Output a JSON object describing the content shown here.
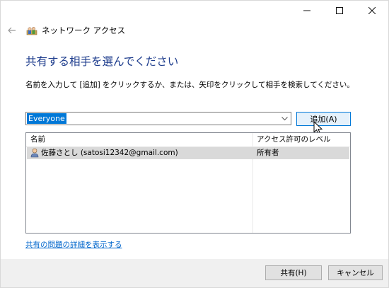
{
  "window": {
    "title": "ネットワーク アクセス",
    "controls": {
      "minimize_icon": "minimize-icon",
      "maximize_icon": "maximize-icon",
      "close_icon": "close-icon"
    }
  },
  "header": {
    "back_icon": "back-arrow-icon",
    "app_icon": "network-users-icon"
  },
  "heading": "共有する相手を選んでください",
  "instruction": "名前を入力して [追加] をクリックするか、または、矢印をクリックして相手を検索してください。",
  "combo": {
    "value": "Everyone"
  },
  "add_button": "追加(A)",
  "list": {
    "columns": [
      "名前",
      "アクセス許可のレベル"
    ],
    "rows": [
      {
        "name": "佐藤さとし (satosi12342@gmail.com)",
        "permission": "所有者",
        "selected": true
      }
    ]
  },
  "link": "共有の問題の詳細を表示する",
  "footer": {
    "share_button": "共有(H)",
    "cancel_button": "キャンセル"
  },
  "colors": {
    "heading": "#1c3b8c",
    "accent": "#0078d7",
    "link": "#0066cc",
    "selected_row": "#d9d9d9"
  }
}
